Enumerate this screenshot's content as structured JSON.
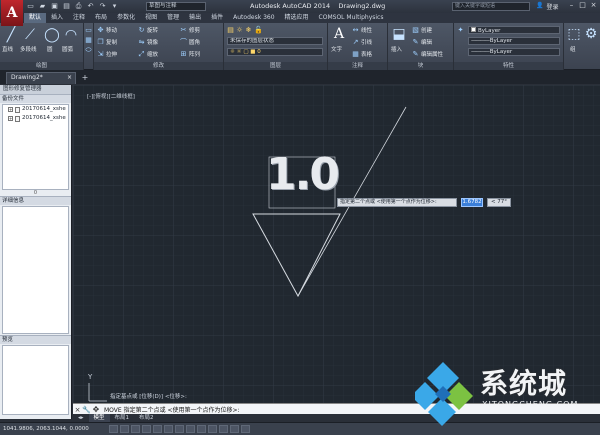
{
  "titlebar": {
    "logo": "A",
    "workspace": "草图与注释",
    "title_app": "Autodesk AutoCAD 2014",
    "title_file": "Drawing2.dwg",
    "search_placeholder": "键入关键字或短语",
    "login": "登录"
  },
  "ribbon_tabs": [
    "默认",
    "插入",
    "注释",
    "布局",
    "参数化",
    "视图",
    "管理",
    "输出",
    "插件",
    "Autodesk 360",
    "精选应用",
    "COMSOL Multiphysics"
  ],
  "ribbon": {
    "draw": {
      "title": "绘图",
      "line": "直线",
      "polyline": "多段线",
      "circle": "圆",
      "arc": "圆弧"
    },
    "modify": {
      "title": "修改",
      "move": "移动",
      "rotate": "旋转",
      "trim": "修剪",
      "copy": "复制",
      "mirror": "镜像",
      "fillet": "圆角",
      "stretch": "拉伸",
      "scale": "缩放",
      "array": "阵列"
    },
    "layers": {
      "title": "图层",
      "layer_state": "未保存的图层状态"
    },
    "annotation": {
      "title": "注释",
      "text": "文字",
      "linear": "线性",
      "leader": "引线",
      "table": "表格"
    },
    "block": {
      "title": "块",
      "insert": "插入",
      "create": "创建",
      "edit": "编辑",
      "edit_attr": "编辑属性"
    },
    "properties": {
      "title": "特性",
      "color": "ByLayer",
      "linetype": "ByLayer",
      "lineweight": "ByLayer"
    },
    "groups": {
      "label": "组"
    }
  },
  "file_tabs": {
    "active": "Drawing2*"
  },
  "palette": {
    "title": "图形修复管理器",
    "backup_title": "备份文件",
    "files": [
      "20170614_xshe",
      "20170614_xshe"
    ],
    "count": "0",
    "details_title": "详细信息",
    "preview_title": "预览"
  },
  "canvas": {
    "viewport_label": "[-][俯视][二维线框]",
    "big_text": "1.0",
    "prompt": "指定第二个点或 <使用第一个点作为位移>:",
    "coord_value": "1.6782",
    "angle_value": "< 77°",
    "ucs_y": "Y"
  },
  "command": {
    "history": "指定基点或 [位移(D)] <位移>:",
    "line": "MOVE 指定第二个点或 <使用第一个点作为位移>:"
  },
  "layout_tabs": [
    "模型",
    "布局1",
    "布局2"
  ],
  "statusbar": {
    "coords": "1041.9806, 2063.1044, 0.0000"
  },
  "watermark": {
    "brand": "系统城",
    "domain": "XITONGCHENG.COM"
  },
  "colors": {
    "canvas_bg": "#212830",
    "ribbon_bg": "#4e5766",
    "accent": "#3b7fd9"
  }
}
